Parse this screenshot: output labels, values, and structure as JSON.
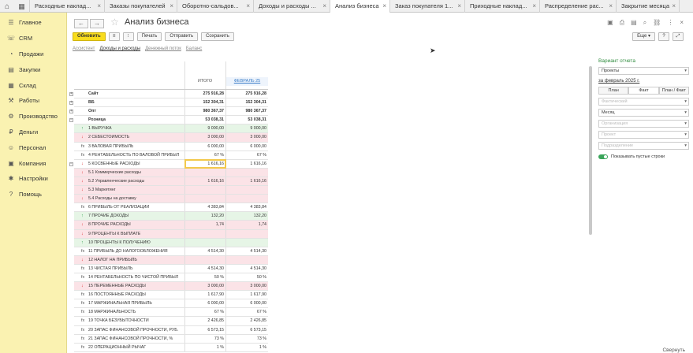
{
  "tabs": [
    {
      "label": "Расходные наклад..."
    },
    {
      "label": "Заказы покупателей"
    },
    {
      "label": "Оборотно-сальдов..."
    },
    {
      "label": "Доходы и расходы ..."
    },
    {
      "label": "Анализ бизнеса"
    },
    {
      "label": "Заказ покупателя 1..."
    },
    {
      "label": "Приходные наклад..."
    },
    {
      "label": "Распределение рас..."
    },
    {
      "label": "Закрытие месяца"
    }
  ],
  "sidebar": {
    "items": [
      {
        "label": "Главное",
        "icon": "☰"
      },
      {
        "label": "CRM",
        "icon": "☏"
      },
      {
        "label": "Продажи",
        "icon": "◔"
      },
      {
        "label": "Закупки",
        "icon": "▤"
      },
      {
        "label": "Склад",
        "icon": "▦"
      },
      {
        "label": "Работы",
        "icon": "⚒"
      },
      {
        "label": "Производство",
        "icon": "⚙"
      },
      {
        "label": "Деньги",
        "icon": "₽"
      },
      {
        "label": "Персонал",
        "icon": "☺"
      },
      {
        "label": "Компания",
        "icon": "▣"
      },
      {
        "label": "Настройки",
        "icon": "✱"
      },
      {
        "label": "Помощь",
        "icon": "?"
      }
    ]
  },
  "header": {
    "title": "Анализ бизнеса",
    "more_label": "Еще ▾",
    "help_label": "?"
  },
  "toolbar": {
    "refresh": "Обновить",
    "print": "Печать",
    "send": "Отправить",
    "save": "Сохранить"
  },
  "sections": [
    "Ассистент",
    "Доходы и расходы",
    "Денежный поток",
    "Баланс"
  ],
  "table": {
    "col_total": "ИТОГО",
    "col_month": "ФЕВРАЛЬ 25",
    "rows": [
      {
        "label": "Сайт",
        "v1": "275 916,28",
        "v2": "275 916,28",
        "style": "bold",
        "mark": "",
        "exp": "+"
      },
      {
        "label": "ВБ",
        "v1": "152 304,31",
        "v2": "152 304,31",
        "style": "bold",
        "mark": "",
        "exp": "+"
      },
      {
        "label": "Опт",
        "v1": "980 367,37",
        "v2": "980 367,37",
        "style": "bold",
        "mark": "",
        "exp": "+"
      },
      {
        "label": "Розница",
        "v1": "53 038,31",
        "v2": "53 038,31",
        "style": "bold",
        "mark": "",
        "exp": "−"
      },
      {
        "label": "1   ВЫРУЧКА",
        "v1": "9 000,00",
        "v2": "9 000,00",
        "style": "green",
        "mark": "↑",
        "exp": ""
      },
      {
        "label": "2   СЕБЕСТОИМОСТЬ",
        "v1": "3 000,00",
        "v2": "3 000,00",
        "style": "pink",
        "mark": "↓",
        "exp": ""
      },
      {
        "label": "3   ВАЛОВАЯ ПРИБЫЛЬ",
        "v1": "6 000,00",
        "v2": "6 000,00",
        "style": "",
        "mark": "fx",
        "exp": ""
      },
      {
        "label": "4   РЕНТАБЕЛЬНОСТЬ ПО ВАЛОВОЙ ПРИБЫЛ",
        "v1": "67 %",
        "v2": "67 %",
        "style": "",
        "mark": "fx",
        "exp": ""
      },
      {
        "label": "5   КОСВЕННЫЕ РАСХОДЫ",
        "v1": "1 616,16",
        "v2": "1 616,16",
        "style": "",
        "mark": "↓",
        "exp": "−",
        "selected": true
      },
      {
        "label": "   5.1   Коммерческие расходы",
        "v1": "",
        "v2": "",
        "style": "pink",
        "mark": "↓",
        "exp": ""
      },
      {
        "label": "   5.2   Управленческие расходы",
        "v1": "1 616,16",
        "v2": "1 616,16",
        "style": "pink",
        "mark": "↓",
        "exp": ""
      },
      {
        "label": "   5.3   Маркетинг",
        "v1": "",
        "v2": "",
        "style": "pink",
        "mark": "↓",
        "exp": ""
      },
      {
        "label": "   5.4   Расходы на доставку",
        "v1": "",
        "v2": "",
        "style": "pink",
        "mark": "↓",
        "exp": ""
      },
      {
        "label": "6   ПРИБЫЛЬ ОТ РЕАЛИЗАЦИИ",
        "v1": "4 383,84",
        "v2": "4 383,84",
        "style": "",
        "mark": "fx",
        "exp": ""
      },
      {
        "label": "7   ПРОЧИЕ ДОХОДЫ",
        "v1": "132,20",
        "v2": "132,20",
        "style": "green",
        "mark": "↑",
        "exp": ""
      },
      {
        "label": "8   ПРОЧИЕ РАСХОДЫ",
        "v1": "1,74",
        "v2": "1,74",
        "style": "pink",
        "mark": "↓",
        "exp": ""
      },
      {
        "label": "9   ПРОЦЕНТЫ К ВЫПЛАТЕ",
        "v1": "",
        "v2": "",
        "style": "pink",
        "mark": "↓",
        "exp": ""
      },
      {
        "label": "10   ПРОЦЕНТЫ К ПОЛУЧЕНИЮ",
        "v1": "",
        "v2": "",
        "style": "green",
        "mark": "↑",
        "exp": ""
      },
      {
        "label": "11   ПРИБЫЛЬ ДО НАЛОГООБЛОЖЕНИЯ",
        "v1": "4 514,30",
        "v2": "4 514,30",
        "style": "",
        "mark": "fx",
        "exp": ""
      },
      {
        "label": "12   НАЛОГ НА ПРИБЫЛЬ",
        "v1": "",
        "v2": "",
        "style": "pink",
        "mark": "↓",
        "exp": ""
      },
      {
        "label": "13   ЧИСТАЯ ПРИБЫЛЬ",
        "v1": "4 514,30",
        "v2": "4 514,30",
        "style": "",
        "mark": "fx",
        "exp": ""
      },
      {
        "label": "14   РЕНТАБЕЛЬНОСТЬ ПО ЧИСТОЙ ПРИБЫЛ",
        "v1": "50 %",
        "v2": "50 %",
        "style": "",
        "mark": "fx",
        "exp": ""
      },
      {
        "label": "15   ПЕРЕМЕННЫЕ РАСХОДЫ",
        "v1": "3 000,00",
        "v2": "3 000,00",
        "style": "pink",
        "mark": "↓",
        "exp": ""
      },
      {
        "label": "16   ПОСТОЯННЫЕ РАСХОДЫ",
        "v1": "1 617,90",
        "v2": "1 617,90",
        "style": "",
        "mark": "fx",
        "exp": ""
      },
      {
        "label": "17   МАРЖИНАЛЬНАЯ ПРИБЫЛЬ",
        "v1": "6 000,00",
        "v2": "6 000,00",
        "style": "",
        "mark": "fx",
        "exp": ""
      },
      {
        "label": "18   МАРЖИНАЛЬНОСТЬ",
        "v1": "67 %",
        "v2": "67 %",
        "style": "",
        "mark": "fx",
        "exp": ""
      },
      {
        "label": "19   ТОЧКА БЕЗУБЫТОЧНОСТИ",
        "v1": "2 426,85",
        "v2": "2 426,85",
        "style": "",
        "mark": "fx",
        "exp": ""
      },
      {
        "label": "20   ЗАПАС ФИНАНСОВОЙ ПРОЧНОСТИ, РУБ.",
        "v1": "6 573,15",
        "v2": "6 573,15",
        "style": "",
        "mark": "fx",
        "exp": ""
      },
      {
        "label": "21   ЗАПАС ФИНАНСОВОЙ ПРОЧНОСТИ, %",
        "v1": "73 %",
        "v2": "73 %",
        "style": "",
        "mark": "fx",
        "exp": ""
      },
      {
        "label": "22   ОПЕРАЦИОННЫЙ РЫЧАГ",
        "v1": "1 %",
        "v2": "1 %",
        "style": "",
        "mark": "fx",
        "exp": ""
      }
    ]
  },
  "right_panel": {
    "header": "Вариант отчета",
    "variant": "Проекты",
    "period": "за февраль 2025 г.",
    "seg": [
      "План",
      "Факт",
      "План / Факт"
    ],
    "scenario": "Фактический",
    "periodicity": "Месяц",
    "org_ph": "Организация",
    "project_ph": "Проект",
    "dept_ph": "Подразделение",
    "show_empty": "Показывать пустые строки"
  },
  "footer": {
    "link": "Свернуть"
  },
  "colors": {
    "sidebar": "#faf2b1",
    "accent": "#f8dc1d",
    "green_row": "#e6f5e6",
    "pink_row": "#fbe3e7"
  }
}
